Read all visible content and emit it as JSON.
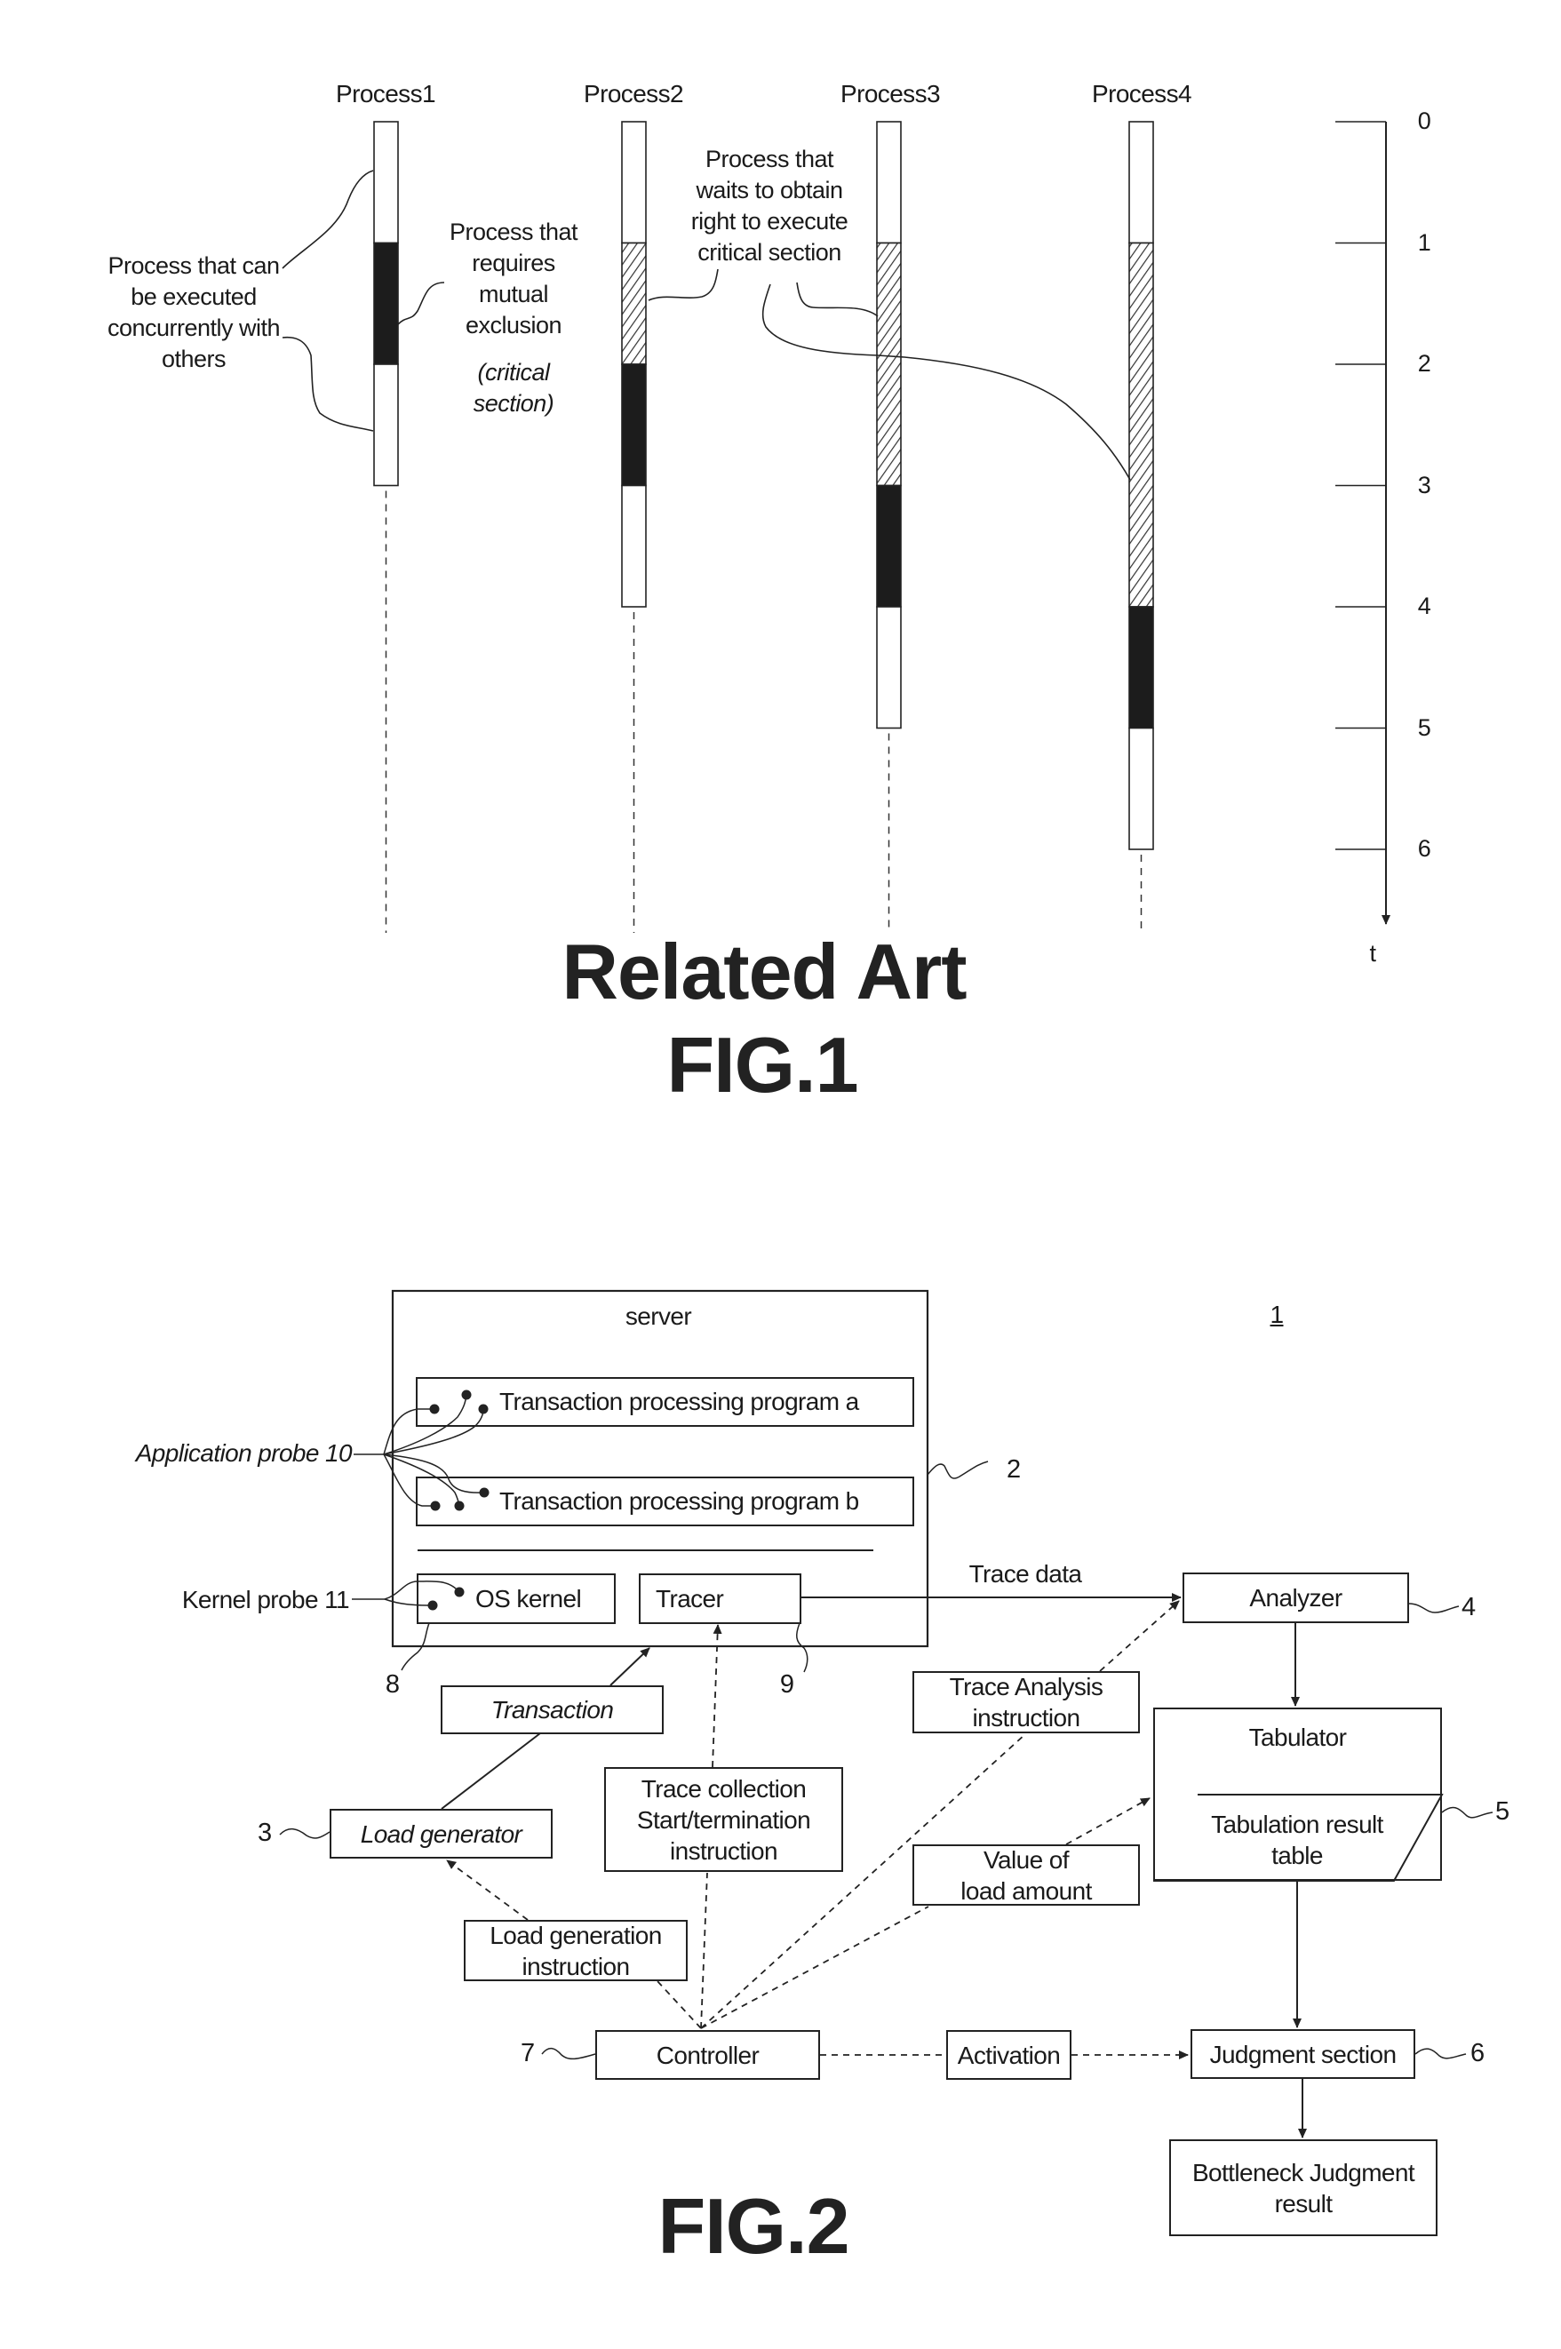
{
  "fig1": {
    "title_line1": "Related Art",
    "title_line2": "FIG.1",
    "processes": [
      {
        "name": "Process1",
        "segments": [
          {
            "from": 0,
            "to": 1,
            "state": "concurrent"
          },
          {
            "from": 1,
            "to": 2,
            "state": "critical"
          },
          {
            "from": 2,
            "to": 3,
            "state": "concurrent"
          }
        ]
      },
      {
        "name": "Process2",
        "segments": [
          {
            "from": 0,
            "to": 1,
            "state": "concurrent"
          },
          {
            "from": 1,
            "to": 2,
            "state": "waiting"
          },
          {
            "from": 2,
            "to": 3,
            "state": "critical"
          },
          {
            "from": 3,
            "to": 4,
            "state": "concurrent"
          }
        ]
      },
      {
        "name": "Process3",
        "segments": [
          {
            "from": 0,
            "to": 1,
            "state": "concurrent"
          },
          {
            "from": 1,
            "to": 3,
            "state": "waiting"
          },
          {
            "from": 3,
            "to": 4,
            "state": "critical"
          },
          {
            "from": 4,
            "to": 5,
            "state": "concurrent"
          }
        ]
      },
      {
        "name": "Process4",
        "segments": [
          {
            "from": 0,
            "to": 1,
            "state": "concurrent"
          },
          {
            "from": 1,
            "to": 4,
            "state": "waiting"
          },
          {
            "from": 4,
            "to": 5,
            "state": "critical"
          },
          {
            "from": 5,
            "to": 6,
            "state": "concurrent"
          }
        ]
      }
    ],
    "time_axis": {
      "label": "t",
      "ticks": [
        "0",
        "1",
        "2",
        "3",
        "4",
        "5",
        "6"
      ]
    },
    "callouts": {
      "concurrent": "Process that can\nbe executed\nconcurrently with\nothers",
      "critical_a": "Process that\nrequires\nmutual\nexclusion",
      "critical_b": "(critical\nsection)",
      "waiting": "Process that\nwaits to obtain\nright to execute\ncritical section"
    },
    "legend_states": {
      "concurrent": "white",
      "waiting": "hatched",
      "critical": "black"
    }
  },
  "fig2": {
    "title": "FIG.2",
    "system_ref": "1",
    "server": {
      "label": "server",
      "ref": "2",
      "program_a": "Transaction processing program a",
      "program_b": "Transaction processing program b",
      "os_kernel": "OS kernel",
      "os_kernel_ref": "8",
      "tracer": "Tracer",
      "tracer_ref": "9"
    },
    "probes": {
      "application": "Application probe 10",
      "kernel": "Kernel probe 11"
    },
    "trace_data": "Trace data",
    "analyzer": {
      "label": "Analyzer",
      "ref": "4"
    },
    "tabulator": {
      "label": "Tabulator",
      "ref": "5",
      "table": "Tabulation result\ntable"
    },
    "judgment": {
      "label": "Judgment section",
      "ref": "6"
    },
    "result": "Bottleneck Judgment\nresult",
    "controller": {
      "label": "Controller",
      "ref": "7"
    },
    "load_generator": {
      "label": "Load generator",
      "ref": "3"
    },
    "messages": {
      "transaction": "Transaction",
      "trace_collection": "Trace collection\nStart/termination\ninstruction",
      "load_generation": "Load generation\ninstruction",
      "trace_analysis": "Trace Analysis\ninstruction",
      "load_amount": "Value of\nload amount",
      "activation": "Activation"
    }
  }
}
